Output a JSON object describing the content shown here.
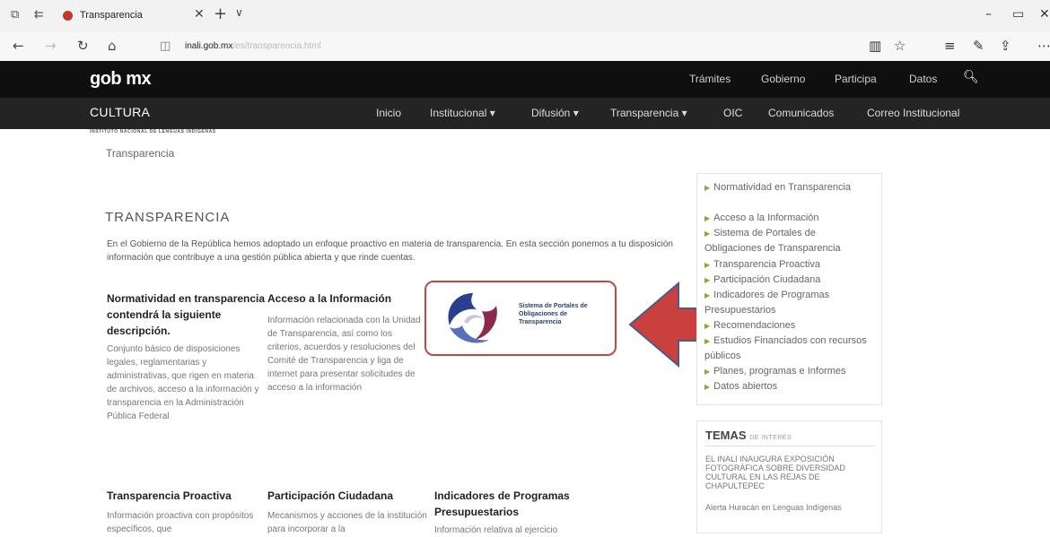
{
  "browser": {
    "tab_title": "Transparencia",
    "url_host": "inali.gob.mx",
    "url_path": "/es/transparencia.html"
  },
  "site": {
    "logo": "gob mx",
    "top_nav": [
      "Trámites",
      "Gobierno",
      "Participa",
      "Datos"
    ],
    "brand": "CULTURA",
    "brand_sub": "INSTITUTO NACIONAL DE LENGUAS INDÍGENAS",
    "main_nav": [
      "Inicio",
      "Institucional ▾",
      "Difusión ▾",
      "Transparencia ▾",
      "OIC",
      "Comunicados",
      "Correo Institucional"
    ]
  },
  "page": {
    "breadcrumb": "Transparencia",
    "title": "TRANSPARENCIA",
    "intro": "En el Gobierno de la República hemos adoptado un enfoque proactivo en materia de transparencia. En esta sección ponemos a tu disposición información que contribuye a una gestión pública abierta y que rinde cuentas."
  },
  "columns": [
    {
      "title": "Normatividad en transparencia contendrá la siguiente descripción.",
      "text": "Conjunto básico de disposiciones legales, reglamentarias y administrativas, que rigen en materia de archivos, acceso a la información y transparencia en la Administración Pública Federal"
    },
    {
      "title": "Acceso a la  Información",
      "text": "Información relacionada con la Unidad de Transparencia, así como los criterios, acuerdos y resoluciones del Comité de Transparencia y liga de internet para presentar solicitudes de acceso a la información"
    },
    {
      "title": "Transparencia Proactiva",
      "text": "Información proactiva con propósitos específicos, que"
    },
    {
      "title": "Participación Ciudadana",
      "text": "Mecanismos y acciones de la institución para incorporar a la"
    },
    {
      "title": "Indicadores de Programas Presupuestarios",
      "text": "Información relativa al ejercicio"
    }
  ],
  "promo": {
    "text": "Sistema de Portales de Obligaciones de Transparencia"
  },
  "sidebar": [
    "Normatividad en Transparencia",
    "Acceso a la Información",
    "Sistema de Portales de Obligaciones de Transparencia",
    "Transparencia Proactiva",
    "Participación Ciudadana",
    "Indicadores de Programas Presupuestarios",
    "Recomendaciones",
    "Estudios Financiados con recursos públicos",
    "Planes, programas e Informes",
    "Datos abiertos"
  ],
  "temas": {
    "title": "TEMAS",
    "subtitle": "DE INTERÉS",
    "items": [
      "EL INALI INAUGURA EXPOSICIÓN FOTOGRÁFICA SOBRE DIVERSIDAD CULTURAL EN LAS REJAS DE CHAPULTEPEC",
      "Alerta Huracán en Lenguas Indígenas"
    ]
  },
  "colors": {
    "accent_green": "#8aa83a",
    "arrow_red": "#c9403e",
    "nav_black": "#0f0f0f"
  }
}
